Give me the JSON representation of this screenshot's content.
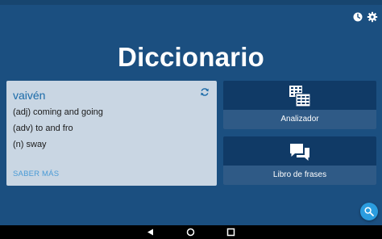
{
  "app": {
    "title": "Diccionario"
  },
  "header": {
    "history_icon": "history-icon",
    "settings_icon": "gear-icon"
  },
  "card": {
    "word": "vaivén",
    "definitions": [
      "(adj) coming and going",
      "(adv) to and fro",
      "(n) sway"
    ],
    "more_label": "SABER MÁS",
    "refresh_icon": "refresh-icon"
  },
  "tiles": {
    "analyzer": {
      "label": "Analizador",
      "icon": "analyzer-icon"
    },
    "phrasebook": {
      "label": "Libro de frases",
      "icon": "phrasebook-icon"
    }
  },
  "fab": {
    "icon": "search-icon"
  },
  "navbar": {
    "back_icon": "nav-back-icon",
    "home_icon": "nav-home-icon",
    "recents_icon": "nav-recents-icon"
  },
  "colors": {
    "background": "#1b4f80",
    "card": "#c9d6e3",
    "tile": "#103a66",
    "tile_label": "#2f5a86",
    "accent": "#2b9ddf",
    "word": "#1a6aa8"
  }
}
